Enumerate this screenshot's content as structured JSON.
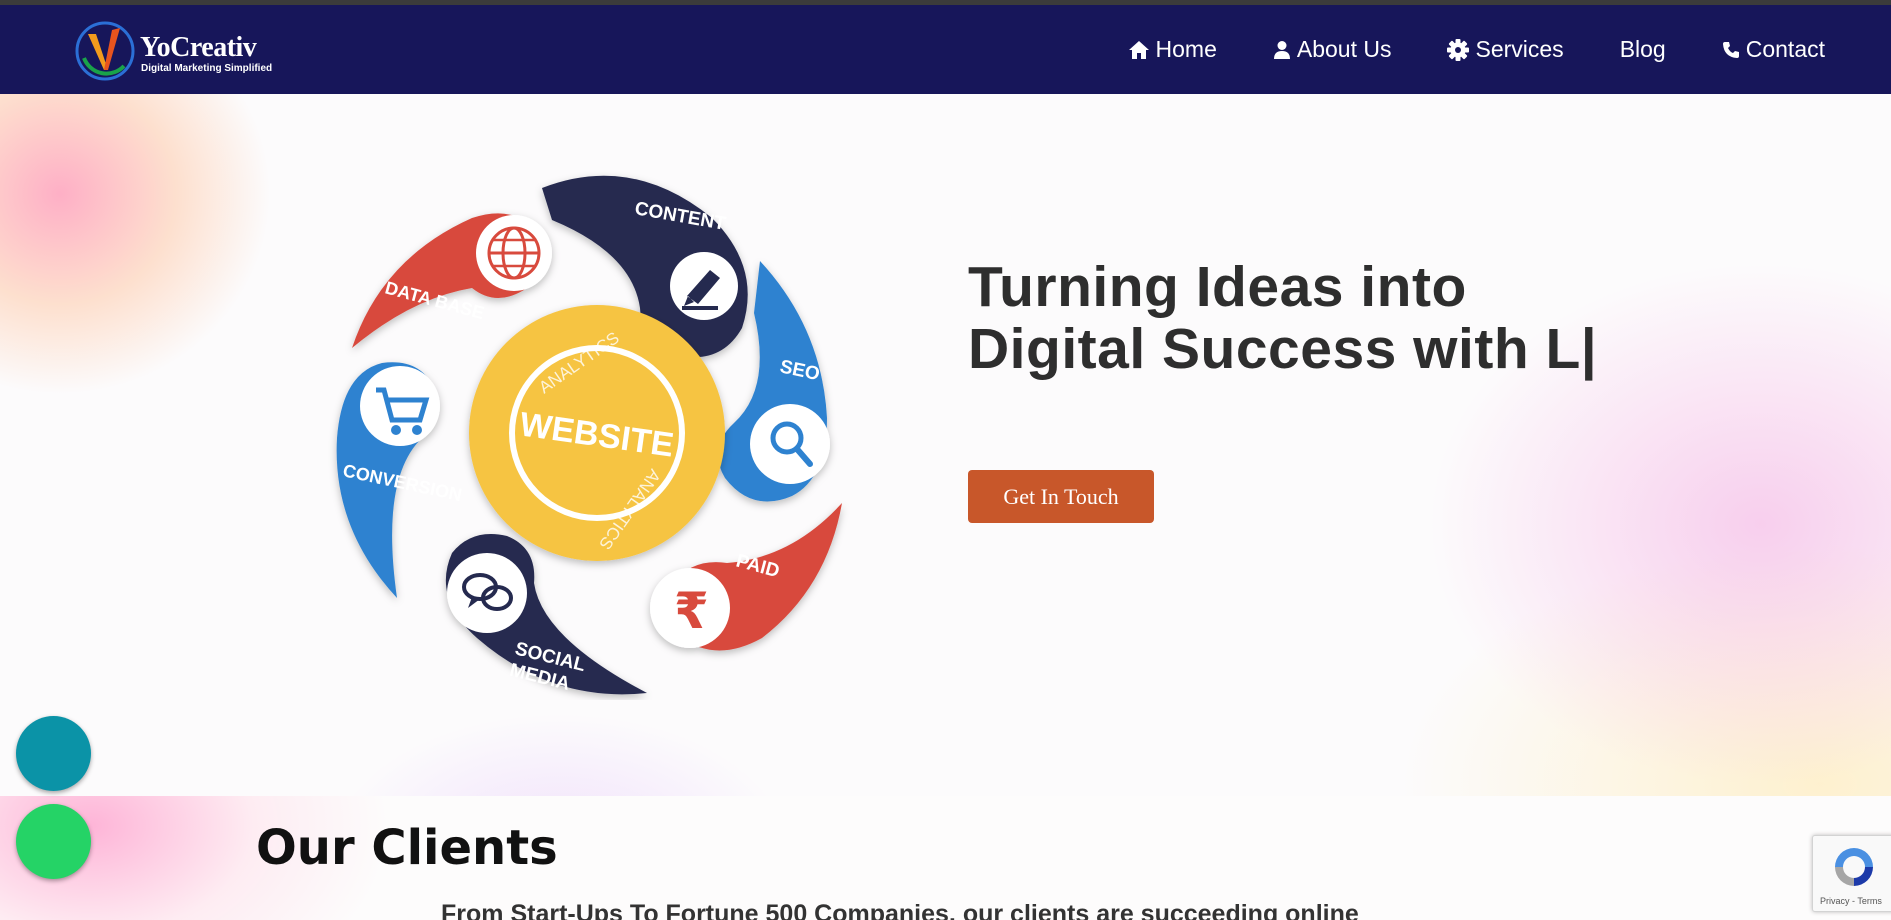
{
  "brand": {
    "name": "YoCreativ",
    "tagline": "Digital Marketing Simplified"
  },
  "nav": {
    "items": [
      {
        "label": "Home",
        "icon": "home-icon"
      },
      {
        "label": "About Us",
        "icon": "user-icon"
      },
      {
        "label": "Services",
        "icon": "gear-icon"
      },
      {
        "label": "Blog",
        "icon": ""
      },
      {
        "label": "Contact",
        "icon": "phone-icon"
      }
    ]
  },
  "hero": {
    "headline": "Turning Ideas into Digital Success with L|",
    "cta_label": "Get In Touch",
    "infographic": {
      "center_label": "WEBSITE",
      "ring_label_top": "ANALYTICS",
      "ring_label_bottom": "ANALYTICS",
      "segments": [
        {
          "label": "CONTENT",
          "icon": "pen-icon",
          "color": "#252a4f"
        },
        {
          "label": "SEO",
          "icon": "magnifier-icon",
          "color": "#2e82d0"
        },
        {
          "label": "PAID",
          "icon": "rupee-icon",
          "color": "#d84a3d"
        },
        {
          "label": "SOCIAL MEDIA",
          "icon": "chat-bubbles-icon",
          "color": "#252a4f"
        },
        {
          "label": "CONVERSION",
          "icon": "cart-icon",
          "color": "#2e82d0"
        },
        {
          "label": "DATA BASE",
          "icon": "globe-icon",
          "color": "#d84a3d"
        }
      ]
    }
  },
  "clients": {
    "title": "Our Clients",
    "subtitle": "From Start-Ups To Fortune 500 Companies, our clients are succeeding online"
  },
  "recaptcha": {
    "text": "Privacy - Terms"
  },
  "colors": {
    "header_bg": "#17165a",
    "cta_bg": "#c8572a",
    "float_teal": "#0b93a7",
    "float_green": "#25d366"
  }
}
